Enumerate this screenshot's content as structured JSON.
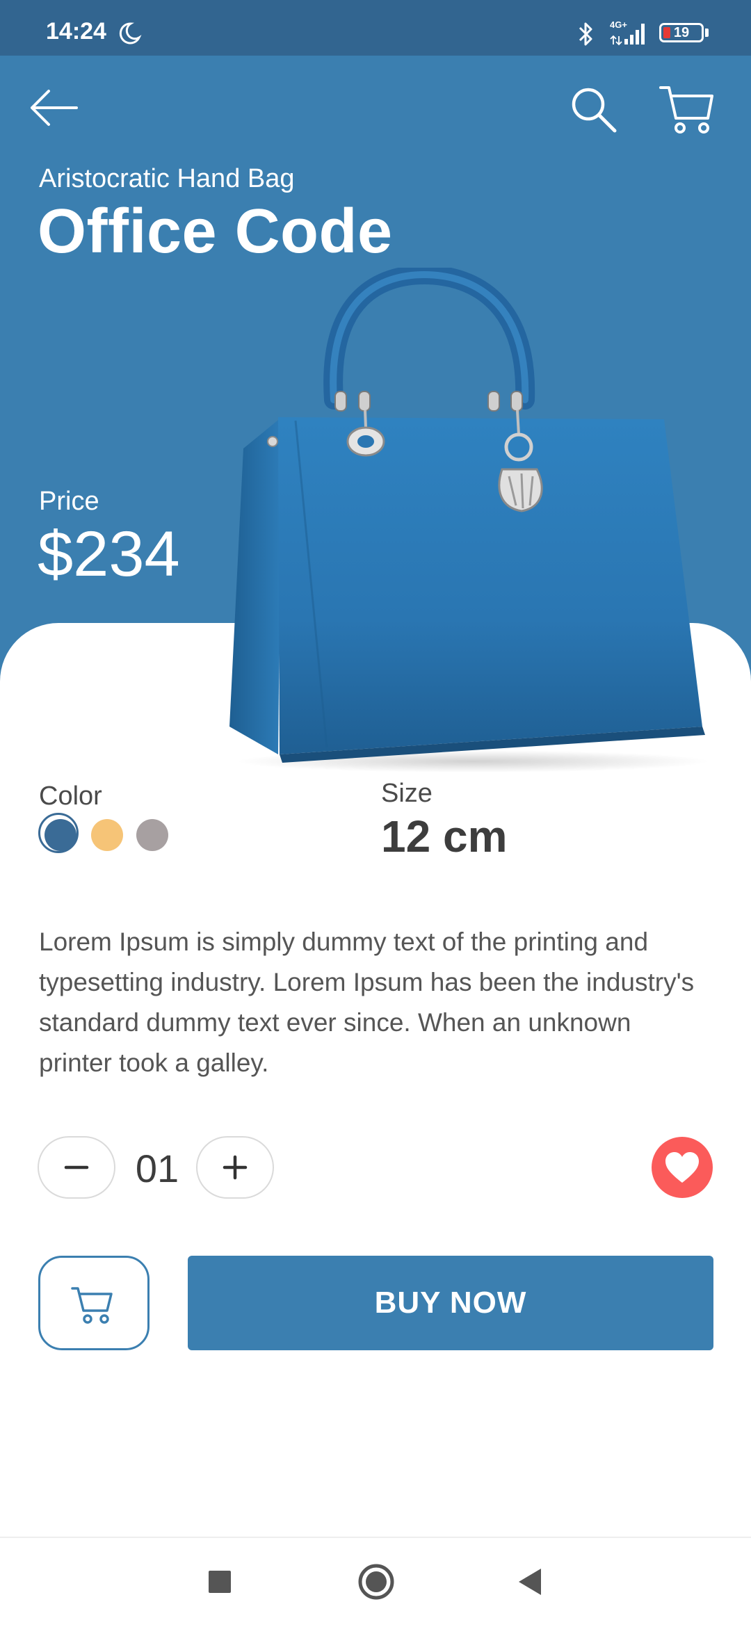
{
  "status_bar": {
    "time": "14:24",
    "network": "4G+",
    "battery": "19"
  },
  "header": {
    "icons": [
      "back-arrow-icon",
      "search-icon",
      "cart-icon"
    ]
  },
  "product": {
    "subtitle": "Aristocratic Hand Bag",
    "title": "Office Code",
    "price_label": "Price",
    "price": "$234",
    "color_label": "Color",
    "colors": [
      "#3a6b96",
      "#f6c477",
      "#a7a0a1"
    ],
    "selected_color": "#3a6b96",
    "size_label": "Size",
    "size": "12 cm",
    "description": "Lorem Ipsum is simply dummy text of the printing and typesetting industry. Lorem Ipsum has been the industry's standard dummy text ever since. When an unknown printer took a galley."
  },
  "quantity": {
    "value": "01"
  },
  "actions": {
    "buy_label": "BUY NOW"
  },
  "theme": {
    "primary": "#3b7fb0",
    "status_bar": "#326590",
    "like": "#fb5b5a"
  }
}
